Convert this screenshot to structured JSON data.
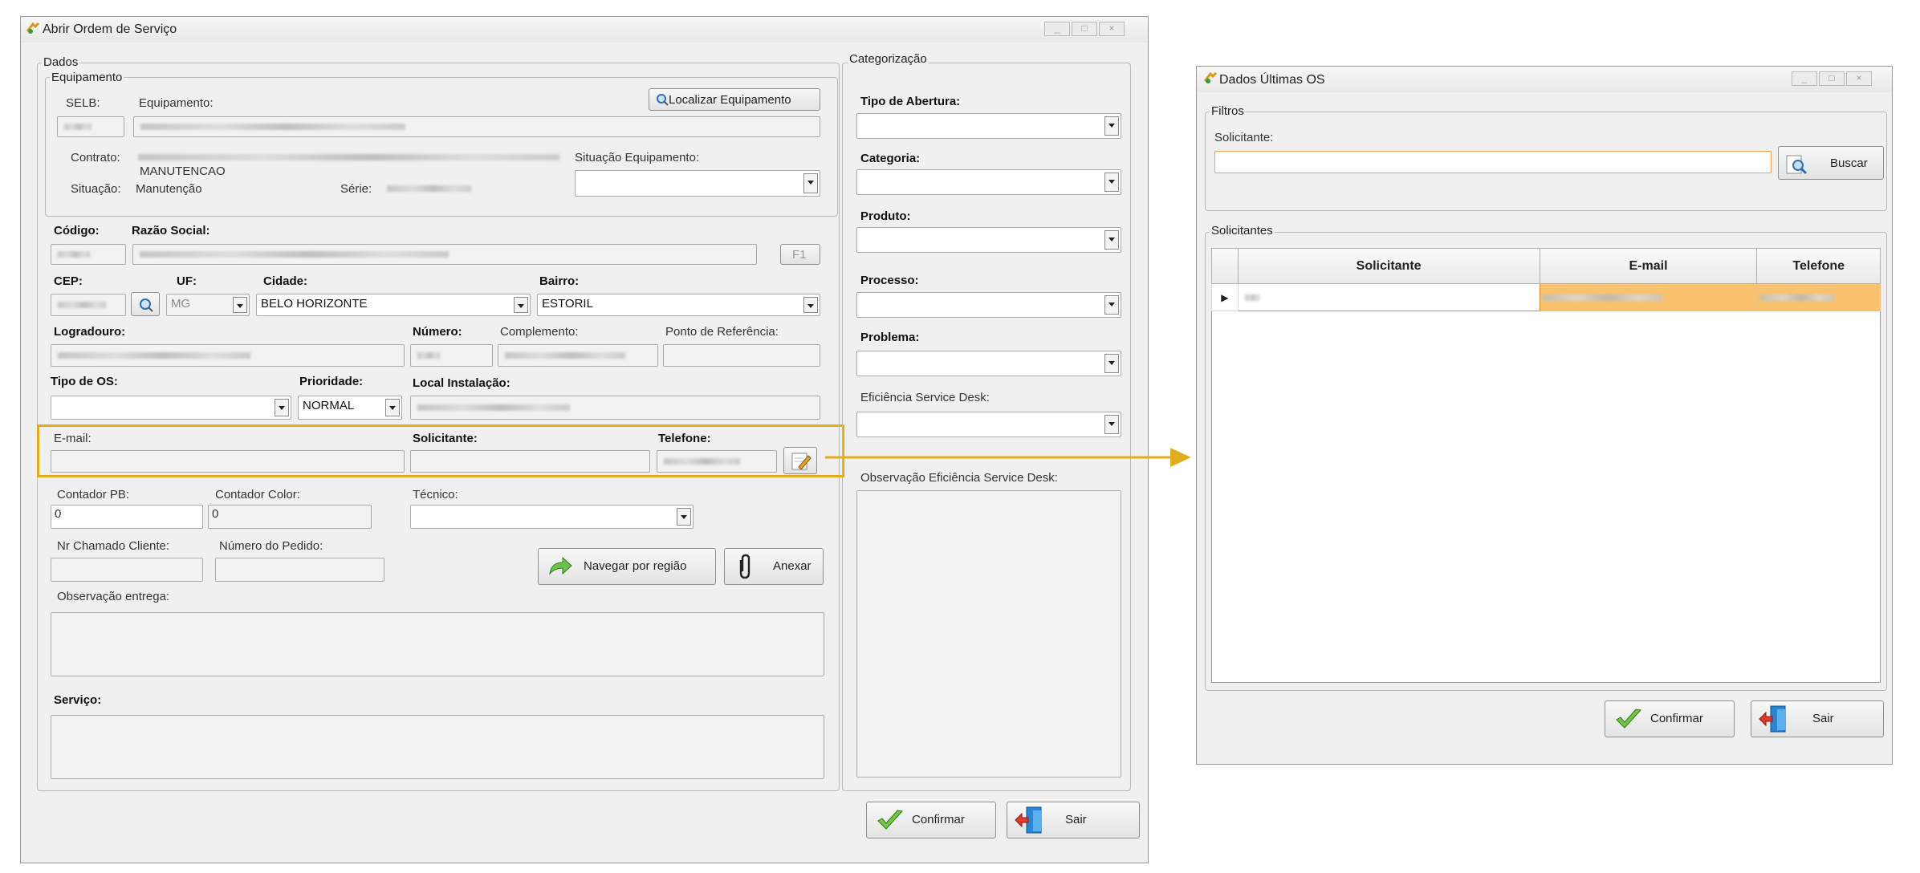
{
  "main_window": {
    "title": "Abrir Ordem de Serviço",
    "dados_legend": "Dados",
    "equipamento_legend": "Equipamento",
    "selb_label": "SELB:",
    "equipamento_label": "Equipamento:",
    "localizar_button": "Localizar Equipamento",
    "contrato_label": "Contrato:",
    "contrato_value_line2": "MANUTENCAO",
    "situacao_equip_label": "Situação Equipamento:",
    "situacao_label": "Situação:",
    "situacao_value": "Manutenção",
    "serie_label": "Série:",
    "codigo_label": "Código:",
    "razao_social_label": "Razão Social:",
    "f1_button": "F1",
    "cep_label": "CEP:",
    "uf_label": "UF:",
    "uf_value": "MG",
    "cidade_label": "Cidade:",
    "cidade_value": "BELO HORIZONTE",
    "bairro_label": "Bairro:",
    "bairro_value": "ESTORIL",
    "logradouro_label": "Logradouro:",
    "numero_label": "Número:",
    "complemento_label": "Complemento:",
    "ponto_ref_label": "Ponto de Referência:",
    "tipo_os_label": "Tipo de OS:",
    "prioridade_label": "Prioridade:",
    "prioridade_value": "NORMAL",
    "local_instalacao_label": "Local Instalação:",
    "email_label": "E-mail:",
    "solicitante_label": "Solicitante:",
    "telefone_label": "Telefone:",
    "contador_pb_label": "Contador PB:",
    "contador_pb_value": "0",
    "contador_color_label": "Contador Color:",
    "contador_color_value": "0",
    "tecnico_label": "Técnico:",
    "nr_chamado_label": "Nr Chamado Cliente:",
    "numero_pedido_label": "Número do Pedido:",
    "navegar_button": "Navegar por região",
    "anexar_button": "Anexar",
    "obs_entrega_label": "Observação entrega:",
    "servico_label": "Serviço:",
    "categorizacao_legend": "Categorização",
    "tipo_abertura_label": "Tipo de Abertura:",
    "categoria_label": "Categoria:",
    "produto_label": "Produto:",
    "processo_label": "Processo:",
    "problema_label": "Problema:",
    "eficiencia_label": "Eficiência Service Desk:",
    "obs_eficiencia_label": "Observação Eficiência Service Desk:",
    "confirmar_button": "Confirmar",
    "sair_button": "Sair"
  },
  "popup_window": {
    "title": "Dados Últimas OS",
    "filtros_legend": "Filtros",
    "solicitante_label": "Solicitante:",
    "buscar_button": "Buscar",
    "solicitantes_legend": "Solicitantes",
    "columns": [
      "Solicitante",
      "E-mail",
      "Telefone"
    ],
    "confirmar_button": "Confirmar",
    "sair_button": "Sair"
  },
  "colors": {
    "highlight": "#e2ad1d",
    "selected_row": "#f8c26e",
    "search_border": "#f0a050"
  },
  "icons": [
    "app-icon",
    "search-icon",
    "edit-icon",
    "navigate-arrow-icon",
    "paperclip-icon",
    "checkmark-icon",
    "exit-door-icon"
  ]
}
